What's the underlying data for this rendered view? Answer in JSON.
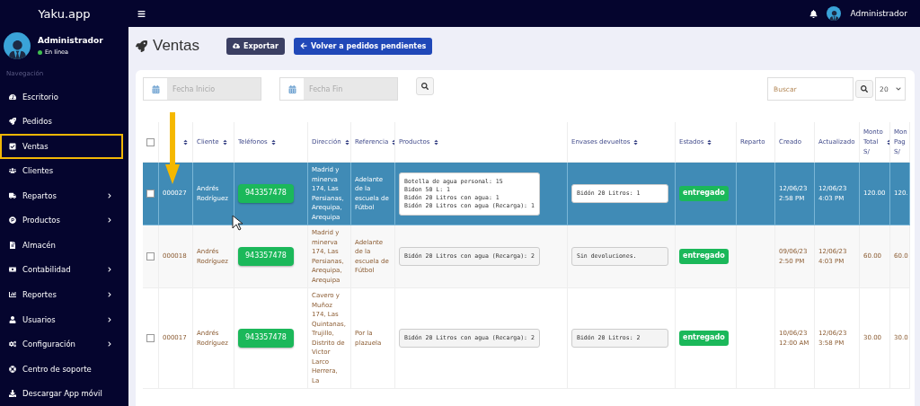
{
  "brand": "Yaku.app",
  "topbar": {
    "user": "Administrador"
  },
  "sidebar": {
    "user": {
      "name": "Administrador",
      "status": "En línea",
      "online": true
    },
    "section": "Navegación",
    "items": [
      {
        "label": "Escritorio",
        "has_submenu": false,
        "selected": false
      },
      {
        "label": "Pedidos",
        "has_submenu": false,
        "selected": false
      },
      {
        "label": "Ventas",
        "has_submenu": false,
        "selected": true
      },
      {
        "label": "Clientes",
        "has_submenu": false,
        "selected": false
      },
      {
        "label": "Repartos",
        "has_submenu": true,
        "selected": false
      },
      {
        "label": "Productos",
        "has_submenu": true,
        "selected": false
      },
      {
        "label": "Almacén",
        "has_submenu": false,
        "selected": false
      },
      {
        "label": "Contabilidad",
        "has_submenu": true,
        "selected": false
      },
      {
        "label": "Reportes",
        "has_submenu": true,
        "selected": false
      },
      {
        "label": "Usuarios",
        "has_submenu": true,
        "selected": false
      },
      {
        "label": "Configuración",
        "has_submenu": true,
        "selected": false
      },
      {
        "label": "Centro de soporte",
        "has_submenu": false,
        "selected": false
      },
      {
        "label": "Descargar App móvil",
        "has_submenu": false,
        "selected": false
      }
    ]
  },
  "page": {
    "title": "Ventas",
    "buttons": [
      {
        "label": "Exportar",
        "kind": "export"
      },
      {
        "label": "Volver a pedidos pendientes",
        "kind": "back"
      }
    ]
  },
  "filters": {
    "start_placeholder": "Fecha Inicio",
    "end_placeholder": "Fecha Fin",
    "search_placeholder": "Buscar",
    "page_size": "20"
  },
  "table": {
    "all_checked": false,
    "columns": [
      "Cliente",
      "Teléfonos",
      "Dirección",
      "Referencia",
      "Productos",
      "Envases devueltos",
      "Estados",
      "Reparto",
      "Creado",
      "Actualizado",
      "Monto Total S/",
      "Mon Pag S/"
    ],
    "rows": [
      {
        "selected": true,
        "checked": false,
        "id": "000027",
        "client": "Andrés Rodríguez",
        "phone": "943357478",
        "address": "Madrid y minerva 174, Las Persianas, Arequipa, Arequipa",
        "reference": "Adelante de la escuela de Fútbol",
        "products": [
          "Botella de agua personal: 15",
          "Bidon 50 L: 1",
          "Bidón 20 Litros con agua: 1",
          "Bidón 20 Litros con agua (Recarga): 1"
        ],
        "returns": "Bidón 20 Litros: 1",
        "status": "entregado",
        "created": "12/06/23 2:58 PM",
        "updated": "12/06/23 4:03 PM",
        "total": "120.00",
        "paid": "120."
      },
      {
        "selected": false,
        "checked": false,
        "id": "000018",
        "client": "Andrés Rodríguez",
        "phone": "943357478",
        "address": "Madrid y minerva 174, Las Persianas, Arequipa, Arequipa",
        "reference": "Adelante de la escuela de Fútbol",
        "products": [
          "Bidón 20 Litros con agua (Recarga): 2"
        ],
        "returns": "Sin devoluciones.",
        "status": "entregado",
        "created": "09/06/23 2:50 PM",
        "updated": "12/06/23 4:03 PM",
        "total": "60.00",
        "paid": "60.0"
      },
      {
        "selected": false,
        "checked": false,
        "id": "000017",
        "client": "Andrés Rodríguez",
        "phone": "943357478",
        "address": "Cavero y Muñoz 174, Las Quintanas, Trujillo, Distrito de Victor Larco Herrera, La",
        "reference": "Por la plazuela",
        "products": [
          "Bidón 20 Litros con agua (Recarga): 2"
        ],
        "returns": "Bidón 20 Litros: 2",
        "status": "entregado",
        "created": "10/06/23 12:00 AM",
        "updated": "12/06/23 3:58 PM",
        "total": "30.00",
        "paid": "30.0"
      }
    ]
  }
}
